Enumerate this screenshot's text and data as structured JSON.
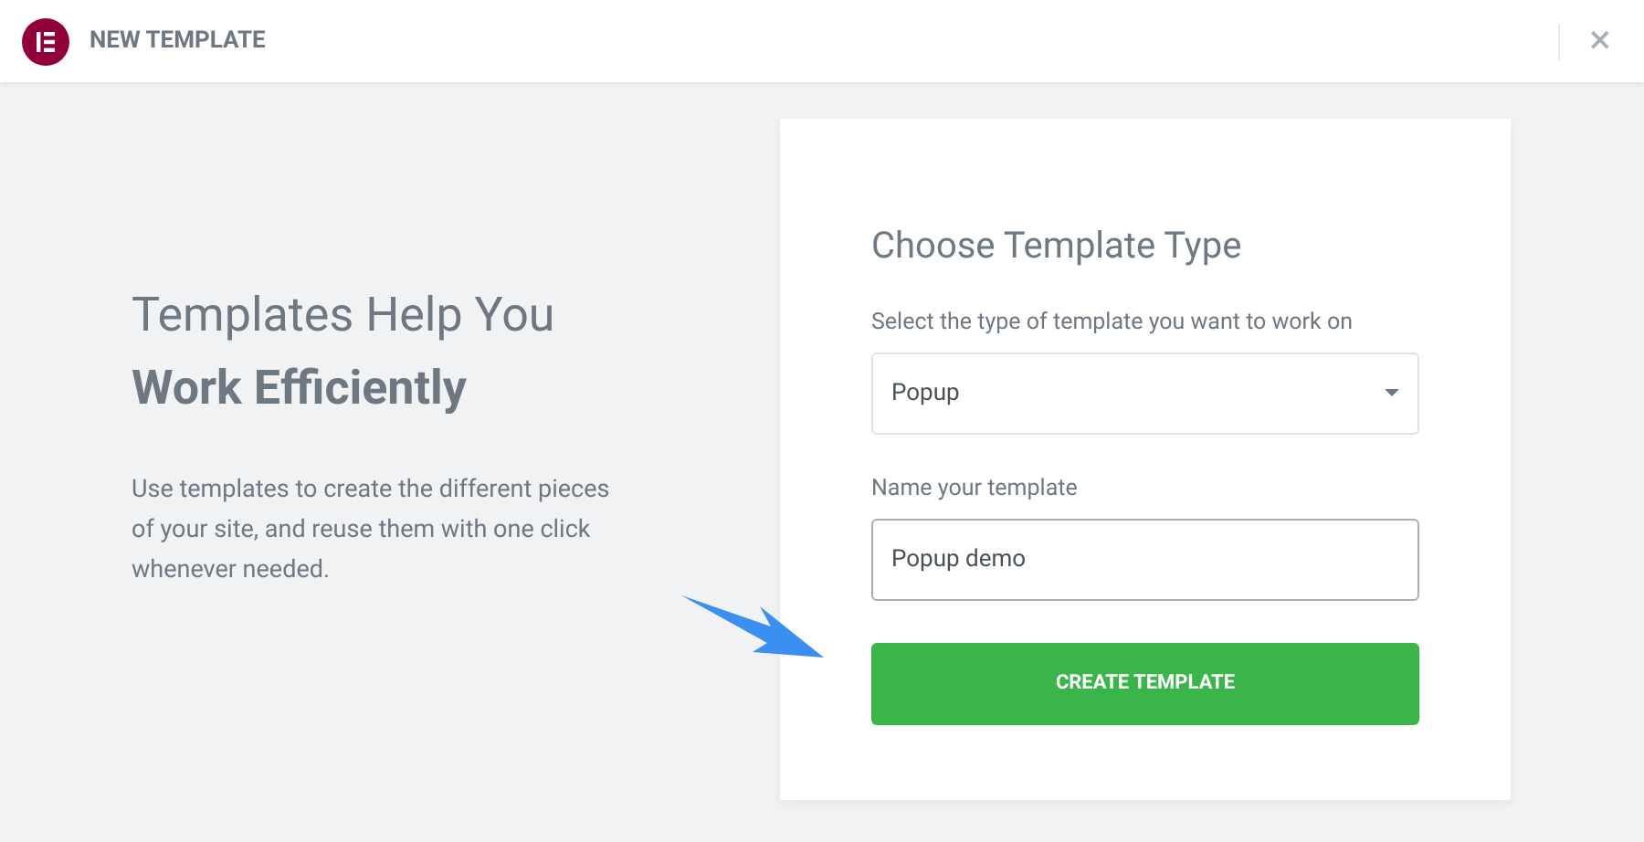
{
  "header": {
    "title": "NEW TEMPLATE",
    "close": "×"
  },
  "intro": {
    "heading": "Templates Help You",
    "heading_bold": "Work Efficiently",
    "description": "Use templates to create the different pieces of your site, and reuse them with one click whenever needed."
  },
  "form": {
    "title": "Choose Template Type",
    "type_label": "Select the type of template you want to work on",
    "type_value": "Popup",
    "name_label": "Name your template",
    "name_value": "Popup demo",
    "name_focused": true,
    "submit": "CREATE TEMPLATE"
  }
}
